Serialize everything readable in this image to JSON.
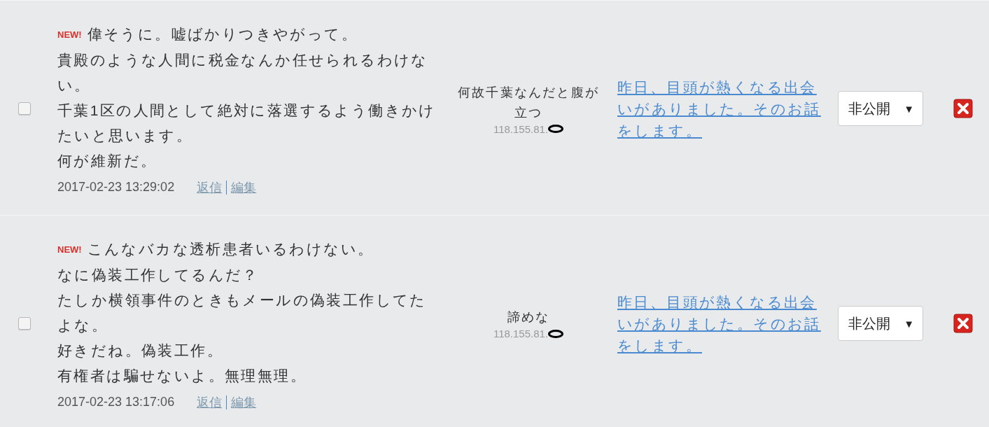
{
  "comments": [
    {
      "checked": false,
      "badge": "NEW!",
      "lines": [
        "偉そうに。嘘ばかりつきやがって。",
        "貴殿のような人間に税金なんか任せられるわけない。",
        "千葉1区の人間として絶対に落選するよう働きかけたいと思います。",
        "何が維新だ。"
      ],
      "date": "2017-02-23 13:29:02",
      "actions": [
        "返信",
        "編集"
      ],
      "author": "何故千葉なんだと腹が立つ",
      "ip": "118.155.81.",
      "post_link": "昨日、目頭が熱くなる出会いがありました。そのお話をします。",
      "visibility": "非公開",
      "caret": "▼"
    },
    {
      "checked": false,
      "badge": "NEW!",
      "lines": [
        "こんなバカな透析患者いるわけない。",
        "なに偽装工作してるんだ？",
        "たしか横領事件のときもメールの偽装工作してたよな。",
        "好きだね。偽装工作。",
        "有権者は騙せないよ。無理無理。"
      ],
      "date": "2017-02-23 13:17:06",
      "actions": [
        "返信",
        "編集"
      ],
      "author": "諦めな",
      "ip": "118.155.81.",
      "post_link": "昨日、目頭が熱くなる出会いがありました。そのお話をします。",
      "visibility": "非公開",
      "caret": "▼"
    }
  ]
}
